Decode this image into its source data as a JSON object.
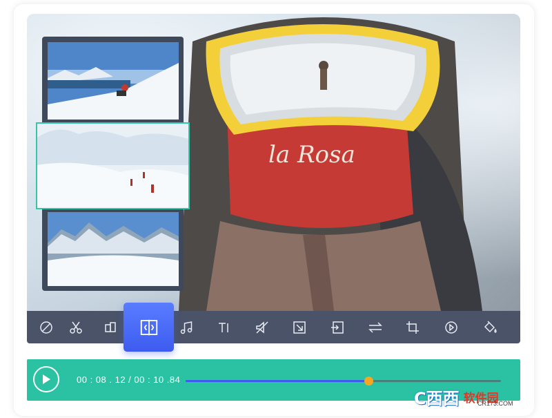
{
  "player": {
    "current_time": "00 : 08 . 12",
    "separator": " / ",
    "total_time": "00 : 10 .84",
    "progress": 0.58
  },
  "toolbar": {
    "tools": [
      {
        "name": "rotate-tool-icon"
      },
      {
        "name": "cut-tool-icon"
      },
      {
        "name": "split-tool-icon"
      },
      {
        "name": "mirror-tool-icon",
        "active": true
      },
      {
        "name": "music-tool-icon"
      },
      {
        "name": "text-tool-icon"
      },
      {
        "name": "mute-tool-icon"
      },
      {
        "name": "resize-tool-icon"
      },
      {
        "name": "export-tool-icon"
      },
      {
        "name": "reverse-tool-icon"
      },
      {
        "name": "crop-tool-icon"
      },
      {
        "name": "speed-tool-icon"
      },
      {
        "name": "fill-tool-icon"
      }
    ]
  },
  "colors": {
    "accent": "#3d5cf0",
    "player_bg": "#2ac2a2",
    "toolbar_bg": "#4a5368",
    "knob": "#f5a623",
    "highlight_border": "#35c6a8"
  },
  "watermark": {
    "logo": "C西西",
    "text": "软件园",
    "sub": "CR173.COM"
  }
}
